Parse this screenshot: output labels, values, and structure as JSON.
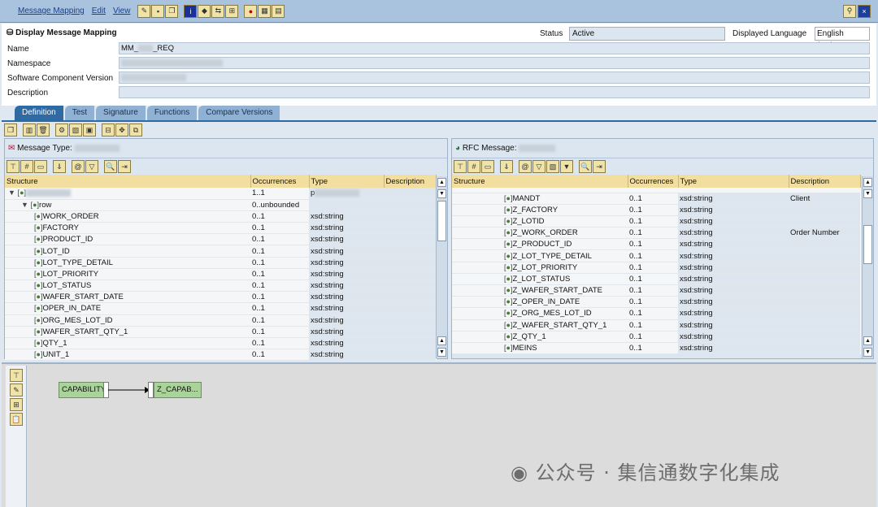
{
  "menu": [
    "Message Mapping",
    "Edit",
    "View"
  ],
  "header": {
    "title": "Display Message Mapping",
    "status_label": "Status",
    "status_value": "Active",
    "lang_label": "Displayed Language",
    "lang_value": "English (OL)",
    "fields": [
      {
        "label": "Name",
        "value": "MM_",
        "suffix": "_REQ"
      },
      {
        "label": "Namespace",
        "value": ""
      },
      {
        "label": "Software Component Version",
        "value": ""
      },
      {
        "label": "Description",
        "value": ""
      }
    ]
  },
  "tabs": [
    "Definition",
    "Test",
    "Signature",
    "Functions",
    "Compare Versions"
  ],
  "active_tab": "Definition",
  "left": {
    "title": "Message Type:",
    "columns": [
      "Structure",
      "Occurrences",
      "Type",
      "Description"
    ],
    "rows": [
      {
        "n": "",
        "o": "1..1",
        "t": "p",
        "d": "",
        "l": 0,
        "e": "▼"
      },
      {
        "n": "row",
        "o": "0..unbounded",
        "t": "",
        "d": "",
        "l": 1,
        "e": "▼"
      },
      {
        "n": "WORK_ORDER",
        "o": "0..1",
        "t": "xsd:string",
        "d": "",
        "l": 2
      },
      {
        "n": "FACTORY",
        "o": "0..1",
        "t": "xsd:string",
        "d": "",
        "l": 2
      },
      {
        "n": "PRODUCT_ID",
        "o": "0..1",
        "t": "xsd:string",
        "d": "",
        "l": 2
      },
      {
        "n": "LOT_ID",
        "o": "0..1",
        "t": "xsd:string",
        "d": "",
        "l": 2
      },
      {
        "n": "LOT_TYPE_DETAIL",
        "o": "0..1",
        "t": "xsd:string",
        "d": "",
        "l": 2
      },
      {
        "n": "LOT_PRIORITY",
        "o": "0..1",
        "t": "xsd:string",
        "d": "",
        "l": 2
      },
      {
        "n": "LOT_STATUS",
        "o": "0..1",
        "t": "xsd:string",
        "d": "",
        "l": 2
      },
      {
        "n": "WAFER_START_DATE",
        "o": "0..1",
        "t": "xsd:string",
        "d": "",
        "l": 2
      },
      {
        "n": "OPER_IN_DATE",
        "o": "0..1",
        "t": "xsd:string",
        "d": "",
        "l": 2
      },
      {
        "n": "ORG_MES_LOT_ID",
        "o": "0..1",
        "t": "xsd:string",
        "d": "",
        "l": 2
      },
      {
        "n": "WAFER_START_QTY_1",
        "o": "0..1",
        "t": "xsd:string",
        "d": "",
        "l": 2
      },
      {
        "n": "QTY_1",
        "o": "0..1",
        "t": "xsd:string",
        "d": "",
        "l": 2
      },
      {
        "n": "UNIT_1",
        "o": "0..1",
        "t": "xsd:string",
        "d": "",
        "l": 2
      }
    ]
  },
  "right": {
    "title": "RFC Message:",
    "columns": [
      "Structure",
      "Occurrences",
      "Type",
      "Description"
    ],
    "rows": [
      {
        "n": "MANDT",
        "o": "0..1",
        "t": "xsd:string",
        "d": "Client"
      },
      {
        "n": "Z_FACTORY",
        "o": "0..1",
        "t": "xsd:string",
        "d": ""
      },
      {
        "n": "Z_LOTID",
        "o": "0..1",
        "t": "xsd:string",
        "d": ""
      },
      {
        "n": "Z_WORK_ORDER",
        "o": "0..1",
        "t": "xsd:string",
        "d": "Order Number"
      },
      {
        "n": "Z_PRODUCT_ID",
        "o": "0..1",
        "t": "xsd:string",
        "d": ""
      },
      {
        "n": "Z_LOT_TYPE_DETAIL",
        "o": "0..1",
        "t": "xsd:string",
        "d": ""
      },
      {
        "n": "Z_LOT_PRIORITY",
        "o": "0..1",
        "t": "xsd:string",
        "d": ""
      },
      {
        "n": "Z_LOT_STATUS",
        "o": "0..1",
        "t": "xsd:string",
        "d": ""
      },
      {
        "n": "Z_WAFER_START_DATE",
        "o": "0..1",
        "t": "xsd:string",
        "d": ""
      },
      {
        "n": "Z_OPER_IN_DATE",
        "o": "0..1",
        "t": "xsd:string",
        "d": ""
      },
      {
        "n": "Z_ORG_MES_LOT_ID",
        "o": "0..1",
        "t": "xsd:string",
        "d": ""
      },
      {
        "n": "Z_WAFER_START_QTY_1",
        "o": "0..1",
        "t": "xsd:string",
        "d": ""
      },
      {
        "n": "Z_QTY_1",
        "o": "0..1",
        "t": "xsd:string",
        "d": ""
      },
      {
        "n": "MEINS",
        "o": "0..1",
        "t": "xsd:string",
        "d": ""
      }
    ]
  },
  "mapping": {
    "source": "CAPABILITY",
    "target": "Z_CAPAB..."
  },
  "watermark": "公众号 · 集信通数字化集成"
}
